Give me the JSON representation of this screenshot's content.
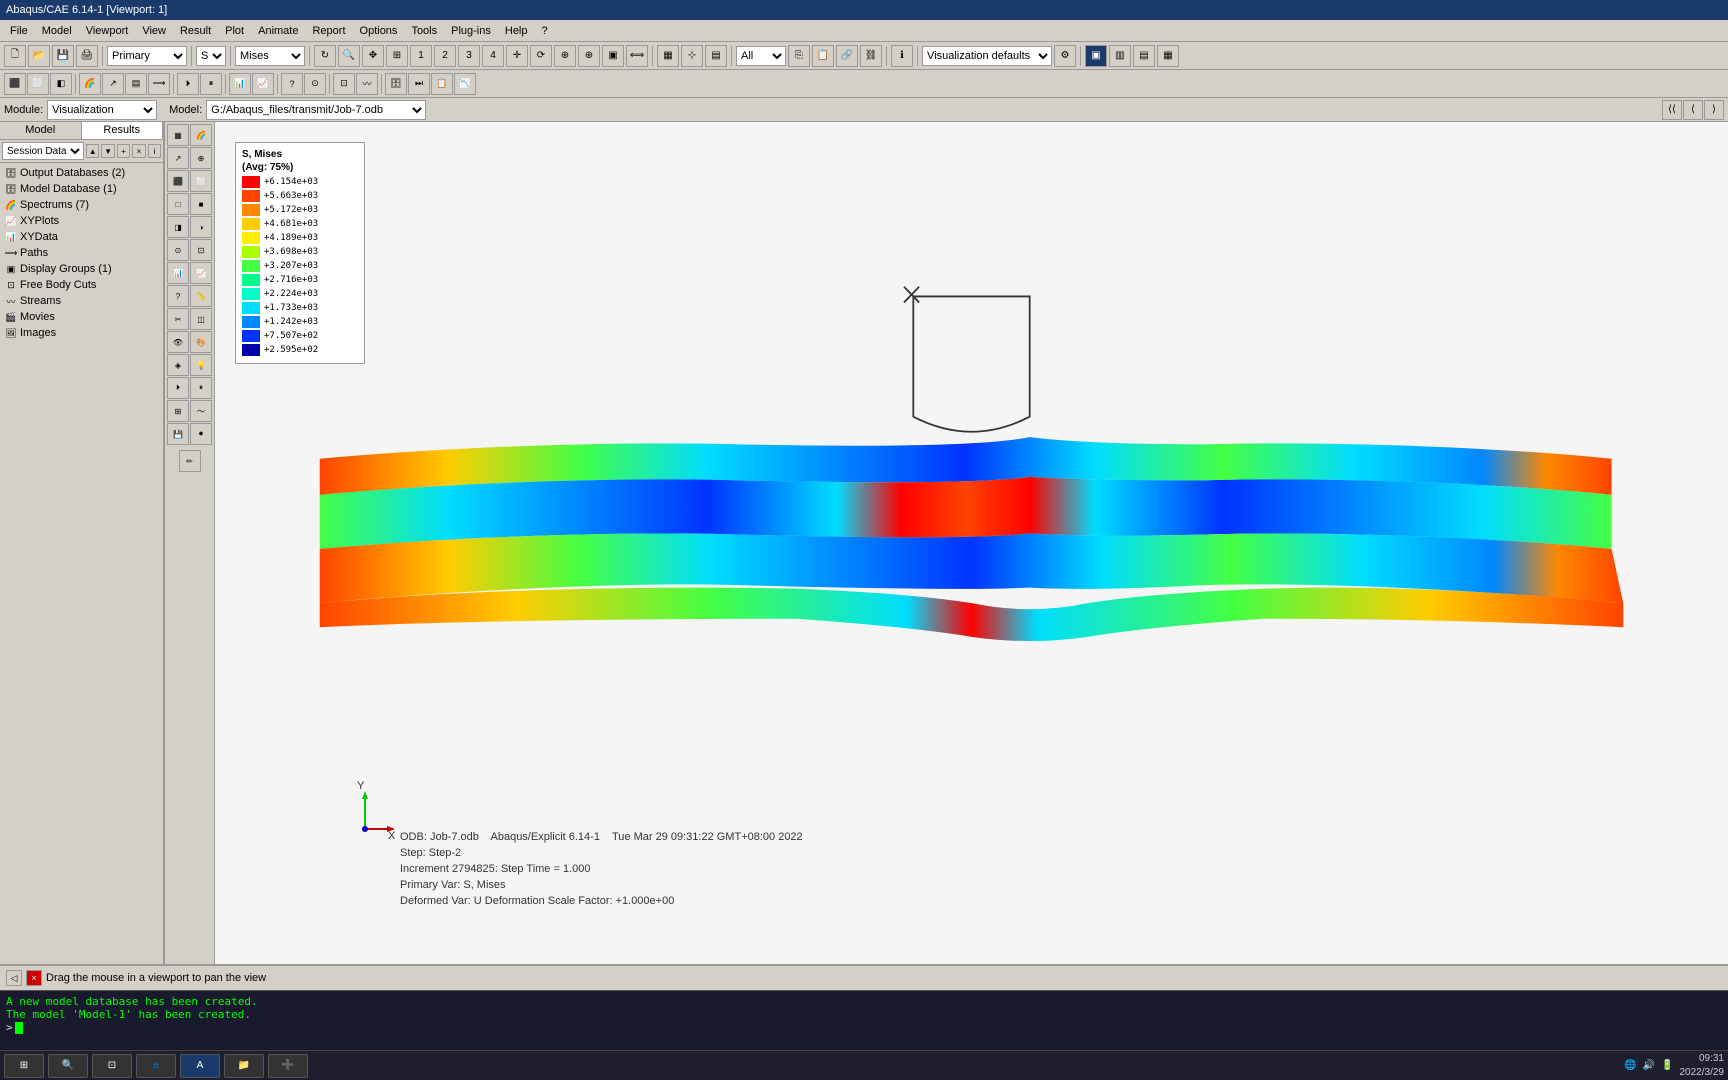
{
  "titlebar": {
    "text": "Abaqus/CAE 6.14-1 [Viewport: 1]"
  },
  "menubar": {
    "items": [
      "File",
      "Model",
      "Viewport",
      "View",
      "Result",
      "Plot",
      "Animate",
      "Report",
      "Options",
      "Tools",
      "Plug-ins",
      "Help",
      "?"
    ]
  },
  "toolbar1": {
    "primary_label": "Primary",
    "primary_options": [
      "Primary"
    ],
    "field_s": "S",
    "field_mises": "Mises",
    "vis_defaults": "Visualization defaults"
  },
  "modulebar": {
    "module_label": "Module:",
    "module_value": "Visualization",
    "model_label": "Model:",
    "model_value": "G:/Abaqus_files/transmit/Job-7.odb"
  },
  "tabs": {
    "model": "Model",
    "results": "Results"
  },
  "session_data": "Session Data",
  "tree": {
    "items": [
      {
        "label": "Output Databases (2)",
        "icon": "db",
        "indent": 0
      },
      {
        "label": "Model Database (1)",
        "icon": "db",
        "indent": 0
      },
      {
        "label": "Spectrums (7)",
        "icon": "sp",
        "indent": 0
      },
      {
        "label": "XYPlots",
        "icon": "xy",
        "indent": 0
      },
      {
        "label": "XYData",
        "icon": "xy",
        "indent": 0
      },
      {
        "label": "Paths",
        "icon": "pt",
        "indent": 0
      },
      {
        "label": "Display Groups (1)",
        "icon": "dg",
        "indent": 0
      },
      {
        "label": "Free Body Cuts",
        "icon": "fb",
        "indent": 0
      },
      {
        "label": "Streams",
        "icon": "st",
        "indent": 0
      },
      {
        "label": "Movies",
        "icon": "mv",
        "indent": 0
      },
      {
        "label": "Images",
        "icon": "im",
        "indent": 0
      }
    ]
  },
  "legend": {
    "title": "S, Mises",
    "subtitle": "(Avg: 75%)",
    "entries": [
      {
        "color": "#FF0000",
        "value": "+6.154e+03"
      },
      {
        "color": "#FF4400",
        "value": "+5.663e+03"
      },
      {
        "color": "#FF8800",
        "value": "+5.172e+03"
      },
      {
        "color": "#FFBB00",
        "value": "+4.681e+03"
      },
      {
        "color": "#FFEE00",
        "value": "+4.189e+03"
      },
      {
        "color": "#AAFF00",
        "value": "+3.698e+03"
      },
      {
        "color": "#44FF44",
        "value": "+3.207e+03"
      },
      {
        "color": "#00FF88",
        "value": "+2.716e+03"
      },
      {
        "color": "#00FFCC",
        "value": "+2.224e+03"
      },
      {
        "color": "#00DDFF",
        "value": "+1.733e+03"
      },
      {
        "color": "#0088FF",
        "value": "+1.242e+03"
      },
      {
        "color": "#0033FF",
        "value": "+7.507e+02"
      },
      {
        "color": "#0000CC",
        "value": "+2.595e+02"
      }
    ]
  },
  "info": {
    "odb": "ODB: Job-7.odb",
    "solver": "Abaqus/Explicit 6.14-1",
    "date": "Tue Mar 29 09:31:22 GMT+08:00 2022",
    "step": "Step: Step-2",
    "increment": "Increment  2794825: Step Time =    1.000",
    "primary_var": "Primary Var: S, Mises",
    "deformed_var": "Deformed Var: U  Deformation Scale Factor:  +1.000e+00"
  },
  "statusbar": {
    "text": "Drag the mouse in a viewport to pan the view"
  },
  "console": {
    "lines": [
      "A new model database has been created.",
      "The model 'Model-1' has been created."
    ]
  },
  "taskbar": {
    "items": [
      "⊞",
      "⊡",
      "✦",
      "🌐",
      "📁",
      "➕"
    ],
    "time": "09:31",
    "date": "2022/3/29"
  }
}
